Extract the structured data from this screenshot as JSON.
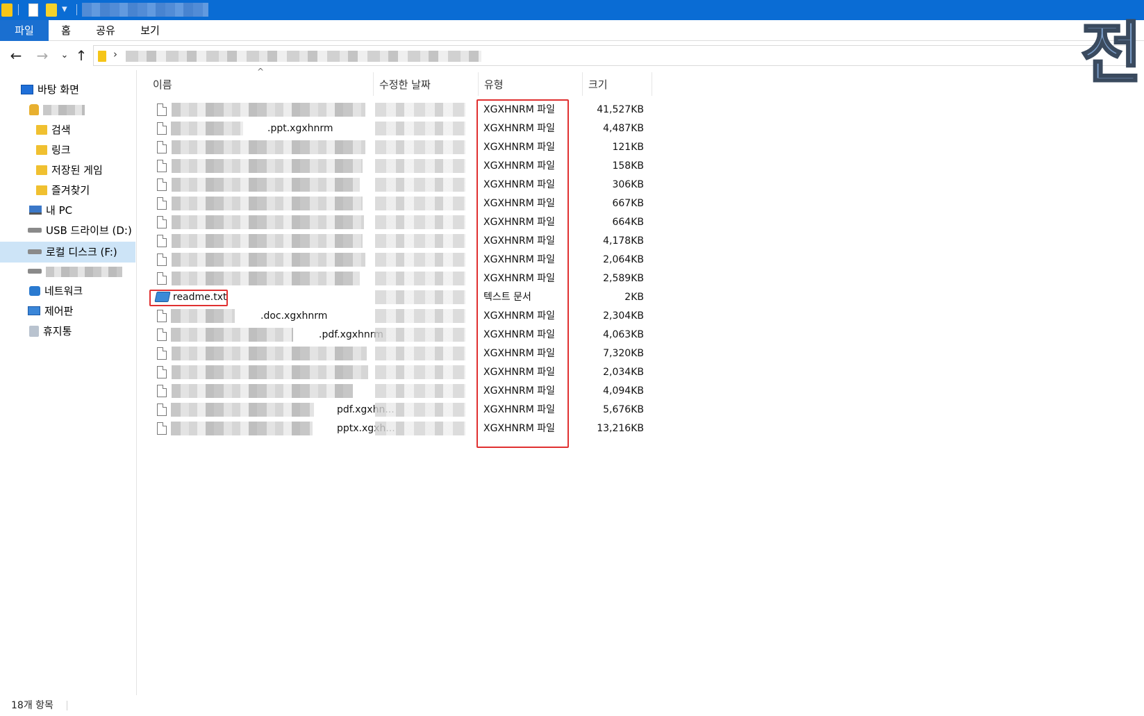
{
  "ribbon": {
    "tabs": [
      "파일",
      "홈",
      "공유",
      "보기"
    ]
  },
  "corner_mark": "전",
  "sidebar": {
    "items": [
      {
        "label": "바탕 화면",
        "icon": "desktop-icon"
      },
      {
        "label": "",
        "icon": "user-icon"
      },
      {
        "label": "검색",
        "icon": "search-folder-icon"
      },
      {
        "label": "링크",
        "icon": "links-folder-icon"
      },
      {
        "label": "저장된 게임",
        "icon": "saved-games-icon"
      },
      {
        "label": "즐겨찾기",
        "icon": "favorites-icon"
      },
      {
        "label": "내 PC",
        "icon": "pc-icon"
      },
      {
        "label": "USB 드라이브 (D:)",
        "icon": "usb-drive-icon"
      },
      {
        "label": "로컬 디스크 (F:)",
        "icon": "local-disk-icon",
        "selected": true
      },
      {
        "label": "",
        "icon": "drive-icon"
      },
      {
        "label": "네트워크",
        "icon": "network-icon"
      },
      {
        "label": "제어판",
        "icon": "control-panel-icon"
      },
      {
        "label": "휴지통",
        "icon": "recycle-bin-icon"
      }
    ]
  },
  "columns": {
    "name": "이름",
    "date": "수정한 날짜",
    "type": "유형",
    "size": "크기"
  },
  "files": [
    {
      "name": "",
      "type": "XGXHNRM 파일",
      "size": "41,527KB"
    },
    {
      "name": ".ppt.xgxhnrm",
      "type": "XGXHNRM 파일",
      "size": "4,487KB"
    },
    {
      "name": "",
      "type": "XGXHNRM 파일",
      "size": "121KB"
    },
    {
      "name": "",
      "type": "XGXHNRM 파일",
      "size": "158KB"
    },
    {
      "name": "",
      "type": "XGXHNRM 파일",
      "size": "306KB"
    },
    {
      "name": "",
      "type": "XGXHNRM 파일",
      "size": "667KB"
    },
    {
      "name": "",
      "type": "XGXHNRM 파일",
      "size": "664KB"
    },
    {
      "name": "",
      "type": "XGXHNRM 파일",
      "size": "4,178KB"
    },
    {
      "name": "",
      "type": "XGXHNRM 파일",
      "size": "2,064KB"
    },
    {
      "name": "",
      "type": "XGXHNRM 파일",
      "size": "2,589KB"
    },
    {
      "name": "readme.txt",
      "type": "텍스트 문서",
      "size": "2KB",
      "icon": "text-document-icon"
    },
    {
      "name": ".doc.xgxhnrm",
      "type": "XGXHNRM 파일",
      "size": "2,304KB"
    },
    {
      "name": ".pdf.xgxhnrm",
      "type": "XGXHNRM 파일",
      "size": "4,063KB"
    },
    {
      "name": "",
      "type": "XGXHNRM 파일",
      "size": "7,320KB"
    },
    {
      "name": "",
      "type": "XGXHNRM 파일",
      "size": "2,034KB"
    },
    {
      "name": "",
      "type": "XGXHNRM 파일",
      "size": "4,094KB"
    },
    {
      "name": "pdf.xgxhn...",
      "type": "XGXHNRM 파일",
      "size": "5,676KB"
    },
    {
      "name": "pptx.xgxh...",
      "type": "XGXHNRM 파일",
      "size": "13,216KB"
    }
  ],
  "status": {
    "item_count": "18개 항목"
  },
  "colors": {
    "accent": "#0a6cd4",
    "highlight": "#e03030",
    "selected": "#cde4f7"
  }
}
